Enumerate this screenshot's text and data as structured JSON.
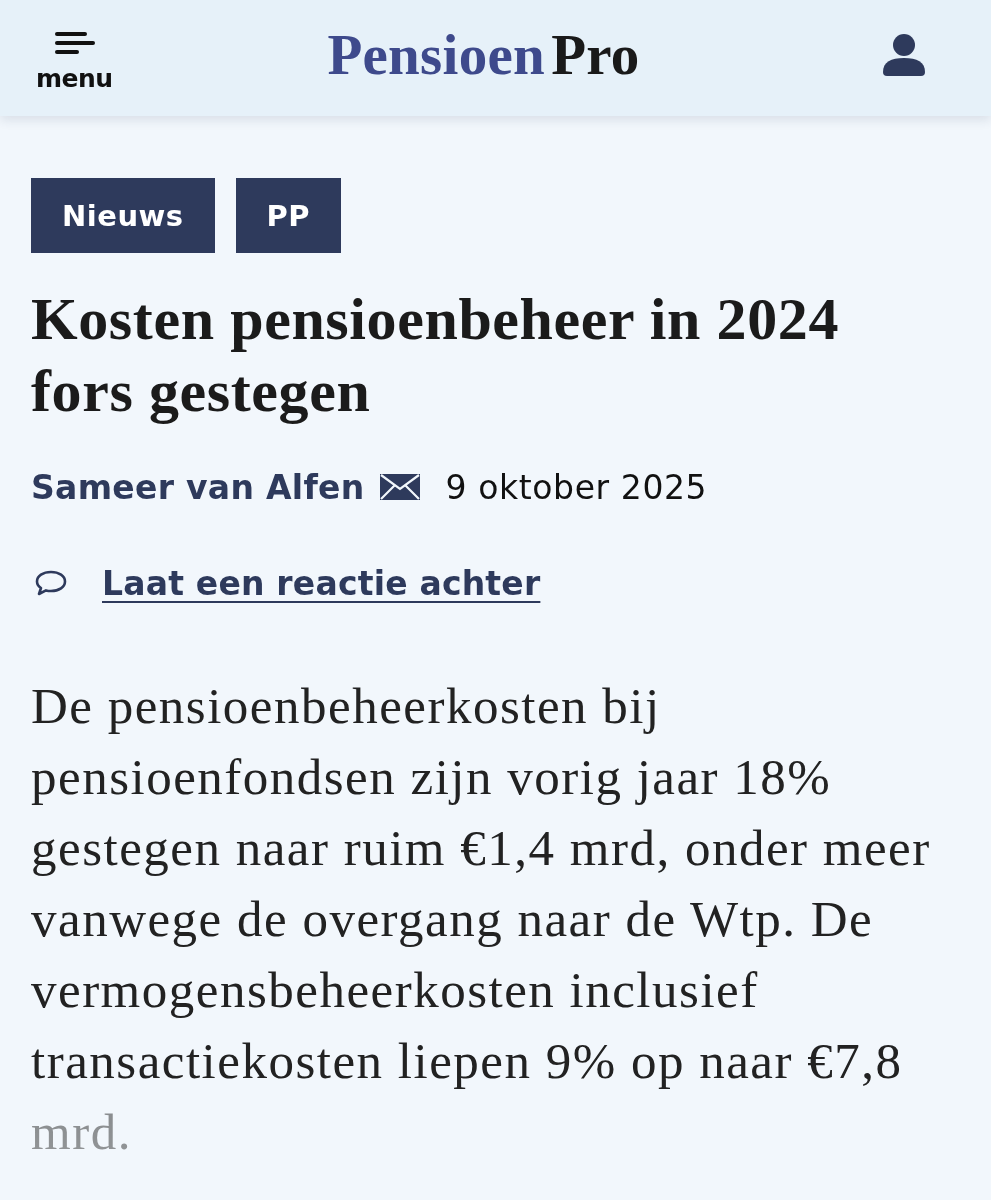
{
  "header": {
    "menu": {
      "label": "menu"
    },
    "logo": {
      "primary": "Pensioen",
      "secondary": "Pro"
    }
  },
  "article": {
    "tags": [
      "Nieuws",
      "PP"
    ],
    "title": "Kosten pensioenbeheer in 2024 fors gestegen",
    "author": "Sameer van Alfen",
    "date": "9 oktober 2025",
    "comment_link": "Laat een reactie achter",
    "lead": {
      "text": "De pensioenbeheerkosten bij pensioenfondsen zijn vorig jaar 18% gestegen naar ruim €1,4 mrd, onder meer vanwege de overgang naar de Wtp. De vermogensbeheerkosten inclusief transactiekosten liepen 9% op naar €7,8 mrd.",
      "faded": true
    }
  }
}
